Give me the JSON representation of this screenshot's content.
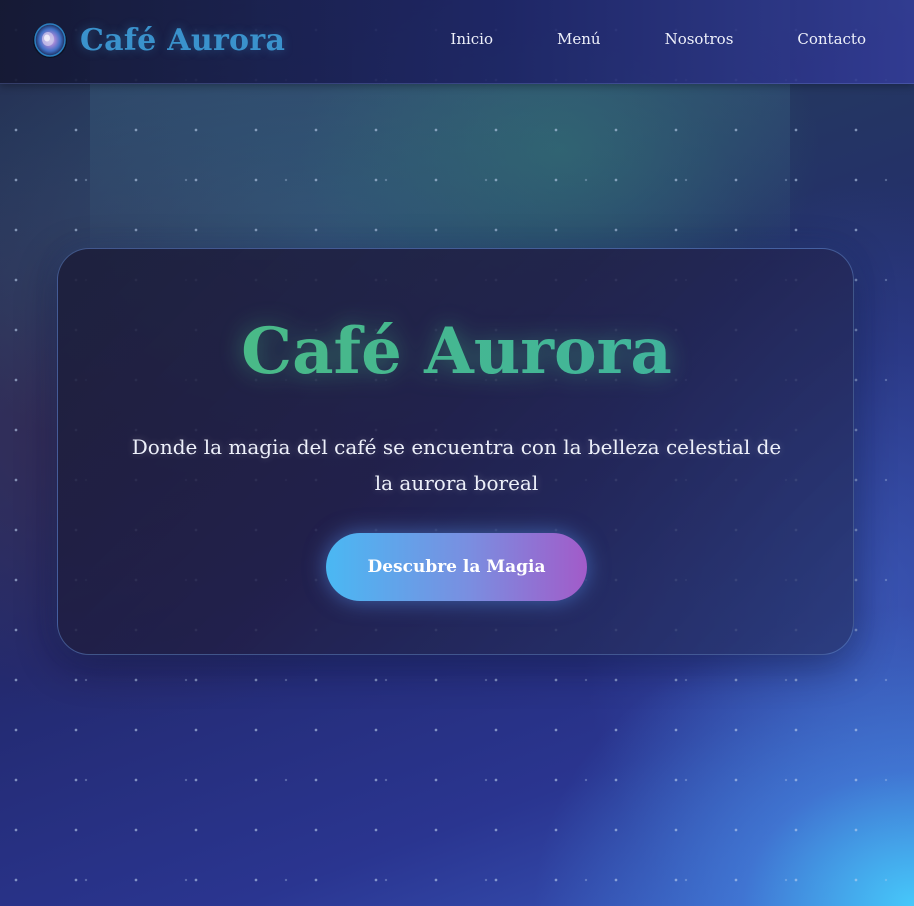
{
  "header": {
    "brand": "Café Aurora",
    "logo_icon": "aurora-orb-icon",
    "nav": [
      {
        "label": "Inicio"
      },
      {
        "label": "Menú"
      },
      {
        "label": "Nosotros"
      },
      {
        "label": "Contacto"
      }
    ]
  },
  "hero": {
    "title": "Café Aurora",
    "subtitle": "Donde la magia del café se encuentra con la belleza celestial de la aurora boreal",
    "cta_label": "Descubre la Magia"
  },
  "colors": {
    "brand_blue": "#3a92cc",
    "title_green": "#46b89a",
    "cta_start": "#4ab8f3",
    "cta_end": "#a25bc9",
    "background_dark": "#1f2468"
  }
}
